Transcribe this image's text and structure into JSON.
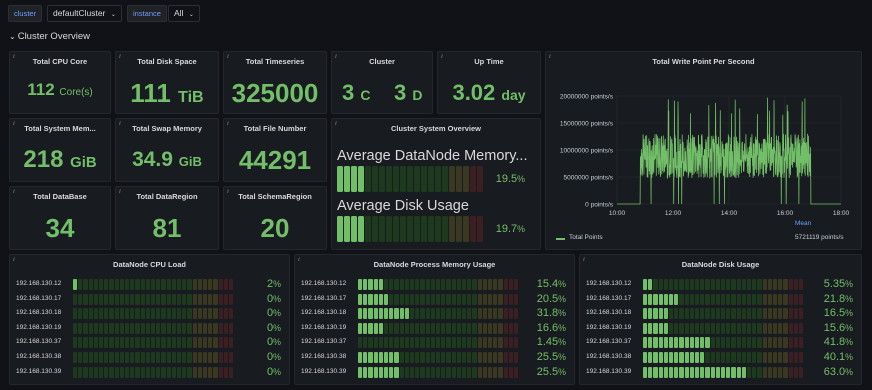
{
  "vars": {
    "cluster_label": "cluster",
    "cluster_value": "defaultCluster",
    "instance_label": "instance",
    "instance_value": "All"
  },
  "row_title": "Cluster Overview",
  "stats": [
    {
      "title": "Total CPU Core",
      "value": "112",
      "unit": "Core(s)"
    },
    {
      "title": "Total Disk Space",
      "value": "111",
      "unit": "TiB"
    },
    {
      "title": "Total Timeseries",
      "value": "325000",
      "unit": ""
    },
    {
      "title": "Cluster",
      "value_c": "3",
      "unit_c": "C",
      "value_d": "3",
      "unit_d": "D"
    },
    {
      "title": "Up Time",
      "value": "3.02",
      "unit": "day"
    },
    {
      "title": "Total System Mem...",
      "value": "218",
      "unit": "GiB"
    },
    {
      "title": "Total Swap Memory",
      "value": "34.9",
      "unit": "GiB"
    },
    {
      "title": "Total File Number",
      "value": "44291",
      "unit": ""
    },
    {
      "title": "Total DataBase",
      "value": "34",
      "unit": ""
    },
    {
      "title": "Total DataRegion",
      "value": "81",
      "unit": ""
    },
    {
      "title": "Total SchemaRegion",
      "value": "20",
      "unit": ""
    }
  ],
  "sys_overview": {
    "title": "Cluster System Overview",
    "items": [
      {
        "name": "Average DataNode Memory...",
        "value": "19.5",
        "fraction": 0.195
      },
      {
        "name": "Average Disk Usage",
        "value": "19.7",
        "fraction": 0.197
      }
    ]
  },
  "write_chart": {
    "title": "Total Write Point Per Second",
    "y_ticks": [
      "20000000 points/s",
      "15000000 points/s",
      "10000000 points/s",
      "5000000 points/s",
      "0 points/s"
    ],
    "x_ticks": [
      "10:00",
      "12:00",
      "14:00",
      "16:00",
      "18:00"
    ],
    "legend_mean_header": "Mean",
    "legend_series": "Total Points",
    "legend_mean": "5721119 points/s"
  },
  "chart_data": {
    "type": "line",
    "title": "Total Write Point Per Second",
    "series": [
      {
        "name": "Total Points"
      }
    ],
    "x_range": [
      "10:00",
      "18:00"
    ],
    "ylim": [
      0,
      20000000
    ],
    "shape": "near zero from 10:00 to about 10:50, then oscillating mostly between about 5000000 and 13000000 points/s with spikes near 20000000 points/s and brief drops to 0 until about 16:55, then 0",
    "mean": 5721119
  },
  "panels": [
    {
      "title": "DataNode CPU Load",
      "rows": [
        {
          "name": "192.168.130.12",
          "value": "2",
          "fraction": 0.02
        },
        {
          "name": "192.168.130.17",
          "value": "0",
          "fraction": 0.0
        },
        {
          "name": "192.168.130.18",
          "value": "0",
          "fraction": 0.0
        },
        {
          "name": "192.168.130.19",
          "value": "0",
          "fraction": 0.0
        },
        {
          "name": "192.168.130.37",
          "value": "0",
          "fraction": 0.0
        },
        {
          "name": "192.168.130.38",
          "value": "0",
          "fraction": 0.0
        },
        {
          "name": "192.168.130.39",
          "value": "0",
          "fraction": 0.0
        }
      ]
    },
    {
      "title": "DataNode Process Memory Usage",
      "rows": [
        {
          "name": "192.168.130.12",
          "value": "15.4",
          "fraction": 0.154
        },
        {
          "name": "192.168.130.17",
          "value": "20.5",
          "fraction": 0.205
        },
        {
          "name": "192.168.130.18",
          "value": "31.8",
          "fraction": 0.318
        },
        {
          "name": "192.168.130.19",
          "value": "16.6",
          "fraction": 0.166
        },
        {
          "name": "192.168.130.37",
          "value": "1.45",
          "fraction": 0.0145
        },
        {
          "name": "192.168.130.38",
          "value": "25.5",
          "fraction": 0.255
        },
        {
          "name": "192.168.130.39",
          "value": "25.5",
          "fraction": 0.255
        }
      ]
    },
    {
      "title": "DataNode Disk Usage",
      "rows": [
        {
          "name": "192.168.130.12",
          "value": "5.35",
          "fraction": 0.0535
        },
        {
          "name": "192.168.130.17",
          "value": "21.8",
          "fraction": 0.218
        },
        {
          "name": "192.168.130.18",
          "value": "16.5",
          "fraction": 0.165
        },
        {
          "name": "192.168.130.19",
          "value": "15.6",
          "fraction": 0.156
        },
        {
          "name": "192.168.130.37",
          "value": "41.8",
          "fraction": 0.418
        },
        {
          "name": "192.168.130.38",
          "value": "40.1",
          "fraction": 0.401
        },
        {
          "name": "192.168.130.39",
          "value": "63.0",
          "fraction": 0.63
        }
      ]
    }
  ],
  "percent_sign": "%",
  "info_glyph": "i",
  "colors": {
    "green": "#73bf69",
    "yellow": "#fade2a",
    "red": "#f2495c",
    "panel": "#181b1f",
    "bg": "#111217",
    "link": "#6e9fff"
  }
}
